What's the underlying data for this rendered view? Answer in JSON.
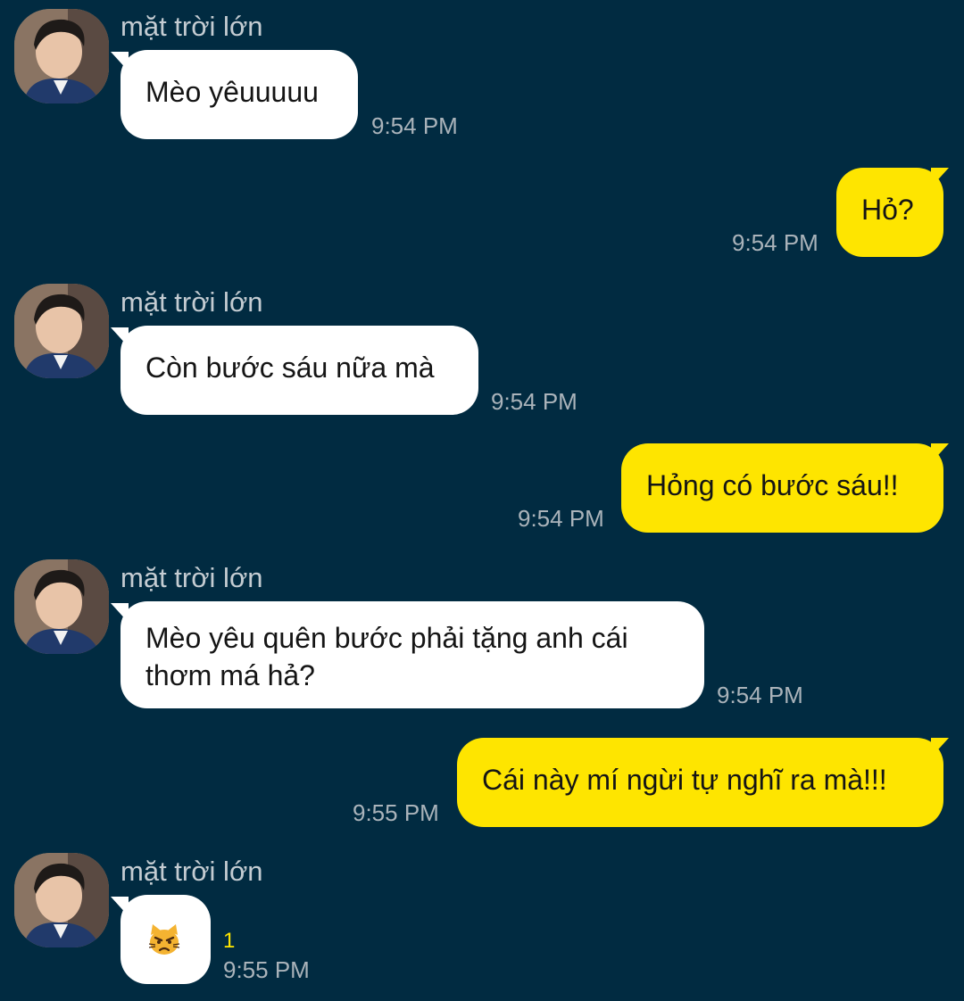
{
  "messages": [
    {
      "type": "incoming",
      "sender": "mặt trời lớn",
      "text": "Mèo yêuuuuu",
      "time": "9:54 PM"
    },
    {
      "type": "outgoing",
      "text": "Hỏ?",
      "time": "9:54 PM"
    },
    {
      "type": "incoming",
      "sender": "mặt trời lớn",
      "text": "Còn bước sáu nữa mà",
      "time": "9:54 PM"
    },
    {
      "type": "outgoing",
      "text": "Hỏng có bước sáu!!",
      "time": "9:54 PM"
    },
    {
      "type": "incoming",
      "sender": "mặt trời lớn",
      "text_line1": "Mèo yêu quên bước phải tặng anh cái",
      "text_line2": "thơm má hả?",
      "time": "9:54 PM"
    },
    {
      "type": "outgoing",
      "text": "Cái này mí ngừi tự nghĩ ra mà!!!",
      "time": "9:55 PM"
    },
    {
      "type": "incoming",
      "sender": "mặt trời lớn",
      "emoji": "pouting-cat-icon",
      "unread_count": "1",
      "time": "9:55 PM"
    }
  ],
  "colors": {
    "background": "#012b41",
    "incoming_bubble": "#ffffff",
    "outgoing_bubble": "#fee500",
    "unread_badge": "#fee500"
  }
}
